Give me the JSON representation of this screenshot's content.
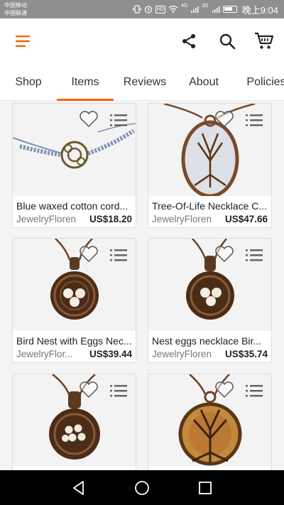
{
  "status_bar": {
    "carrier_1": "中国移动",
    "carrier_2": "中国联通",
    "hd": "HD",
    "network_1": "4G",
    "network_2": "3G",
    "time": "晚上9:04"
  },
  "app_bar": {
    "icons": [
      "menu-icon",
      "share-icon",
      "search-icon",
      "cart-icon"
    ],
    "accent_color": "#f56400"
  },
  "tabs": [
    {
      "label": "Shop",
      "active": false
    },
    {
      "label": "Items",
      "active": true
    },
    {
      "label": "Reviews",
      "active": false
    },
    {
      "label": "About",
      "active": false
    },
    {
      "label": "Policies",
      "active": false
    }
  ],
  "items": [
    {
      "title": "Blue waxed cotton cord...",
      "shop": "JewelryFloren",
      "price": "US$18.20"
    },
    {
      "title": "Tree-Of-Life Necklace C...",
      "shop": "JewelryFloren",
      "price": "US$47.66"
    },
    {
      "title": "Bird Nest with Eggs Nec...",
      "shop": "JewelryFlor...",
      "price": "US$39.44"
    },
    {
      "title": "Nest eggs necklace  Bir...",
      "shop": "JewelryFloren",
      "price": "US$35.74"
    },
    {
      "title": "",
      "shop": "",
      "price": ""
    },
    {
      "title": "",
      "shop": "",
      "price": ""
    }
  ],
  "nav_bar": {
    "icons": [
      "back-icon",
      "home-icon",
      "recents-icon"
    ]
  }
}
